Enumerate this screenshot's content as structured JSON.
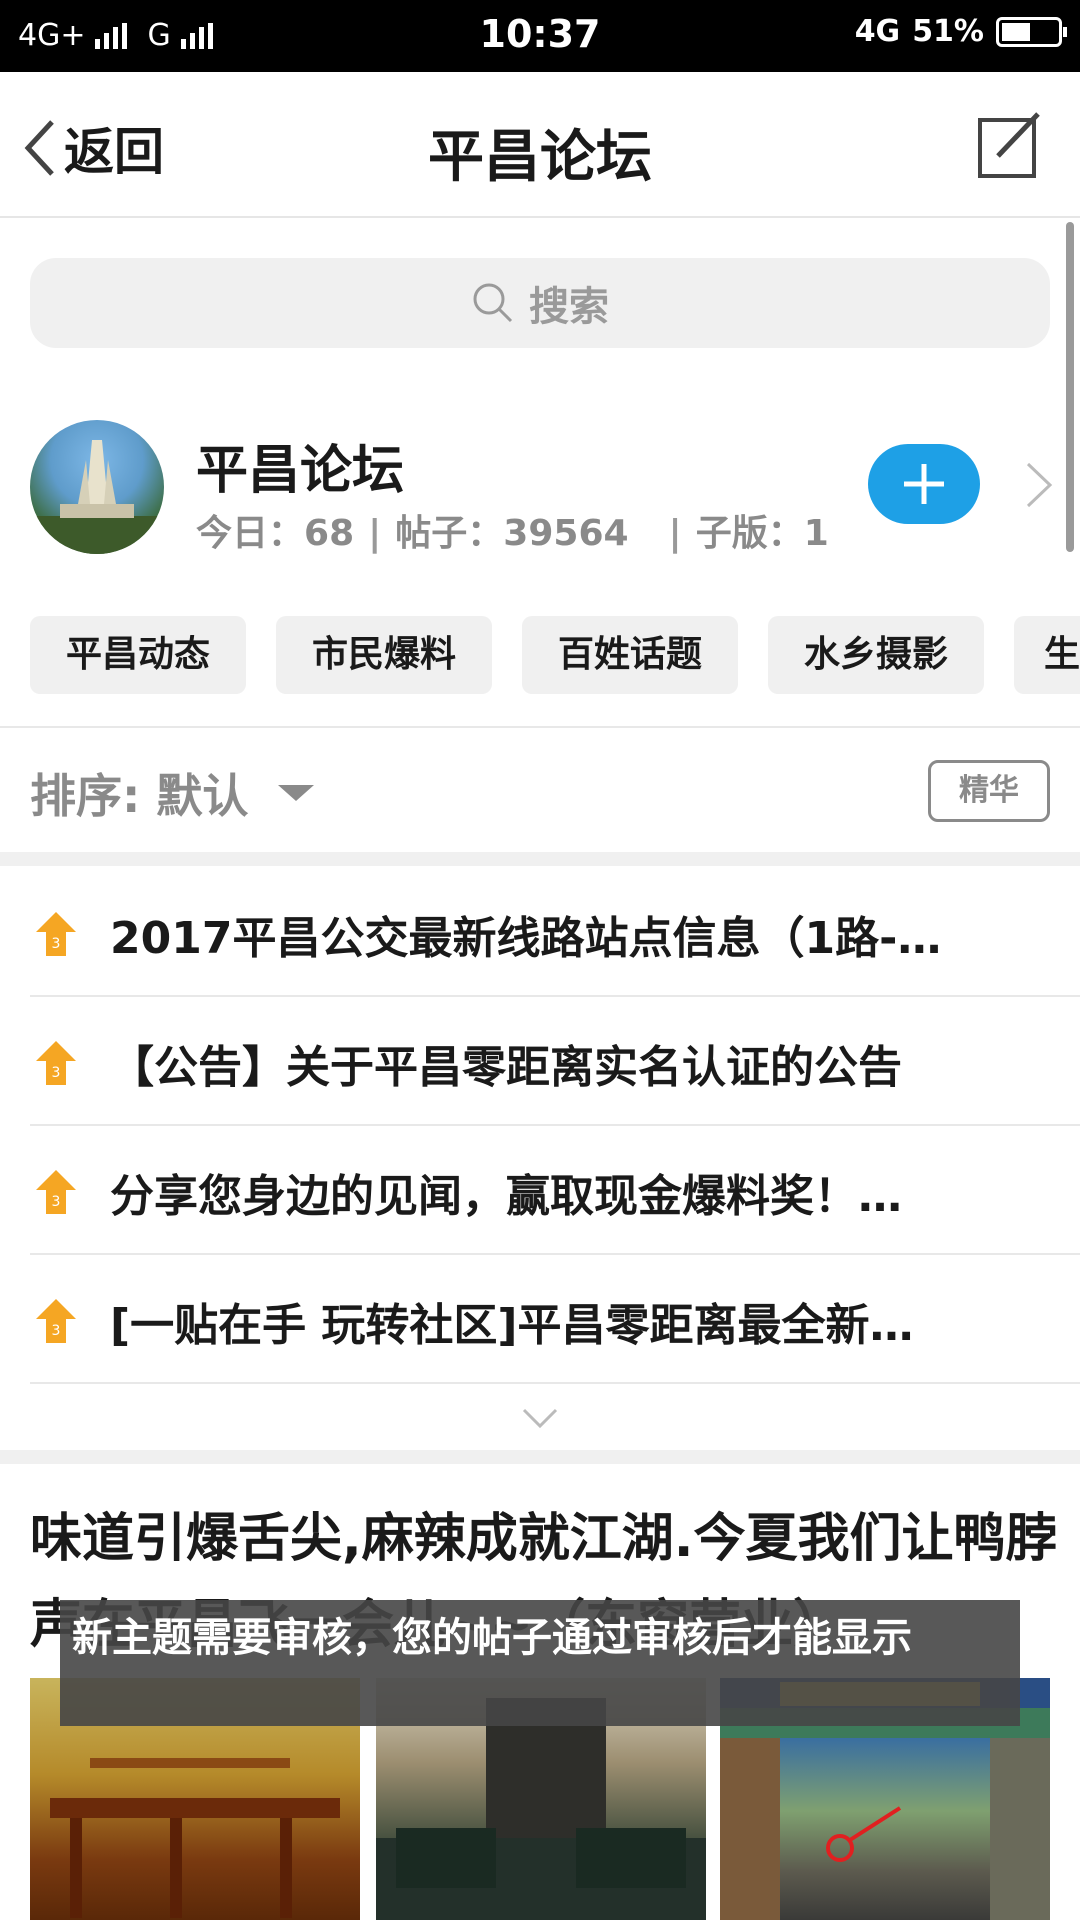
{
  "status_bar": {
    "network_left_1": "4G+",
    "network_left_2": "G",
    "time": "10:37",
    "network_right": "4G",
    "battery_level": 51,
    "battery": "51%"
  },
  "nav": {
    "back_label": "返回",
    "title": "平昌论坛"
  },
  "search": {
    "placeholder": "搜索"
  },
  "forum": {
    "name": "平昌论坛",
    "today_label": "今日：",
    "today_value": "68",
    "posts_label": "帖子：",
    "posts_value": "39564",
    "sub_label": "子版：",
    "sub_value": "1"
  },
  "categories": [
    "平昌动态",
    "市民爆料",
    "百姓话题",
    "水乡摄影",
    "生"
  ],
  "sort": {
    "label": "排序: 默认",
    "filter": "精华"
  },
  "pinned": [
    "2017平昌公交最新线路站点信息（1路-…",
    "【公告】关于平昌零距离实名认证的公告",
    "分享您身边的见闻，赢取现金爆料奖！…",
    "[一贴在手  玩转社区]平昌零距离最全新…"
  ],
  "post": {
    "title": "味道引爆舌尖,麻辣成就江湖.今夏我们让鸭脖声在平昌飞一会儿~~（东窗营业）"
  },
  "toast": {
    "message": "新主题需要审核，您的帖子通过审核后才能显示"
  },
  "colors": {
    "accent": "#1ea0e6",
    "pin_icon": "#f5a623"
  }
}
